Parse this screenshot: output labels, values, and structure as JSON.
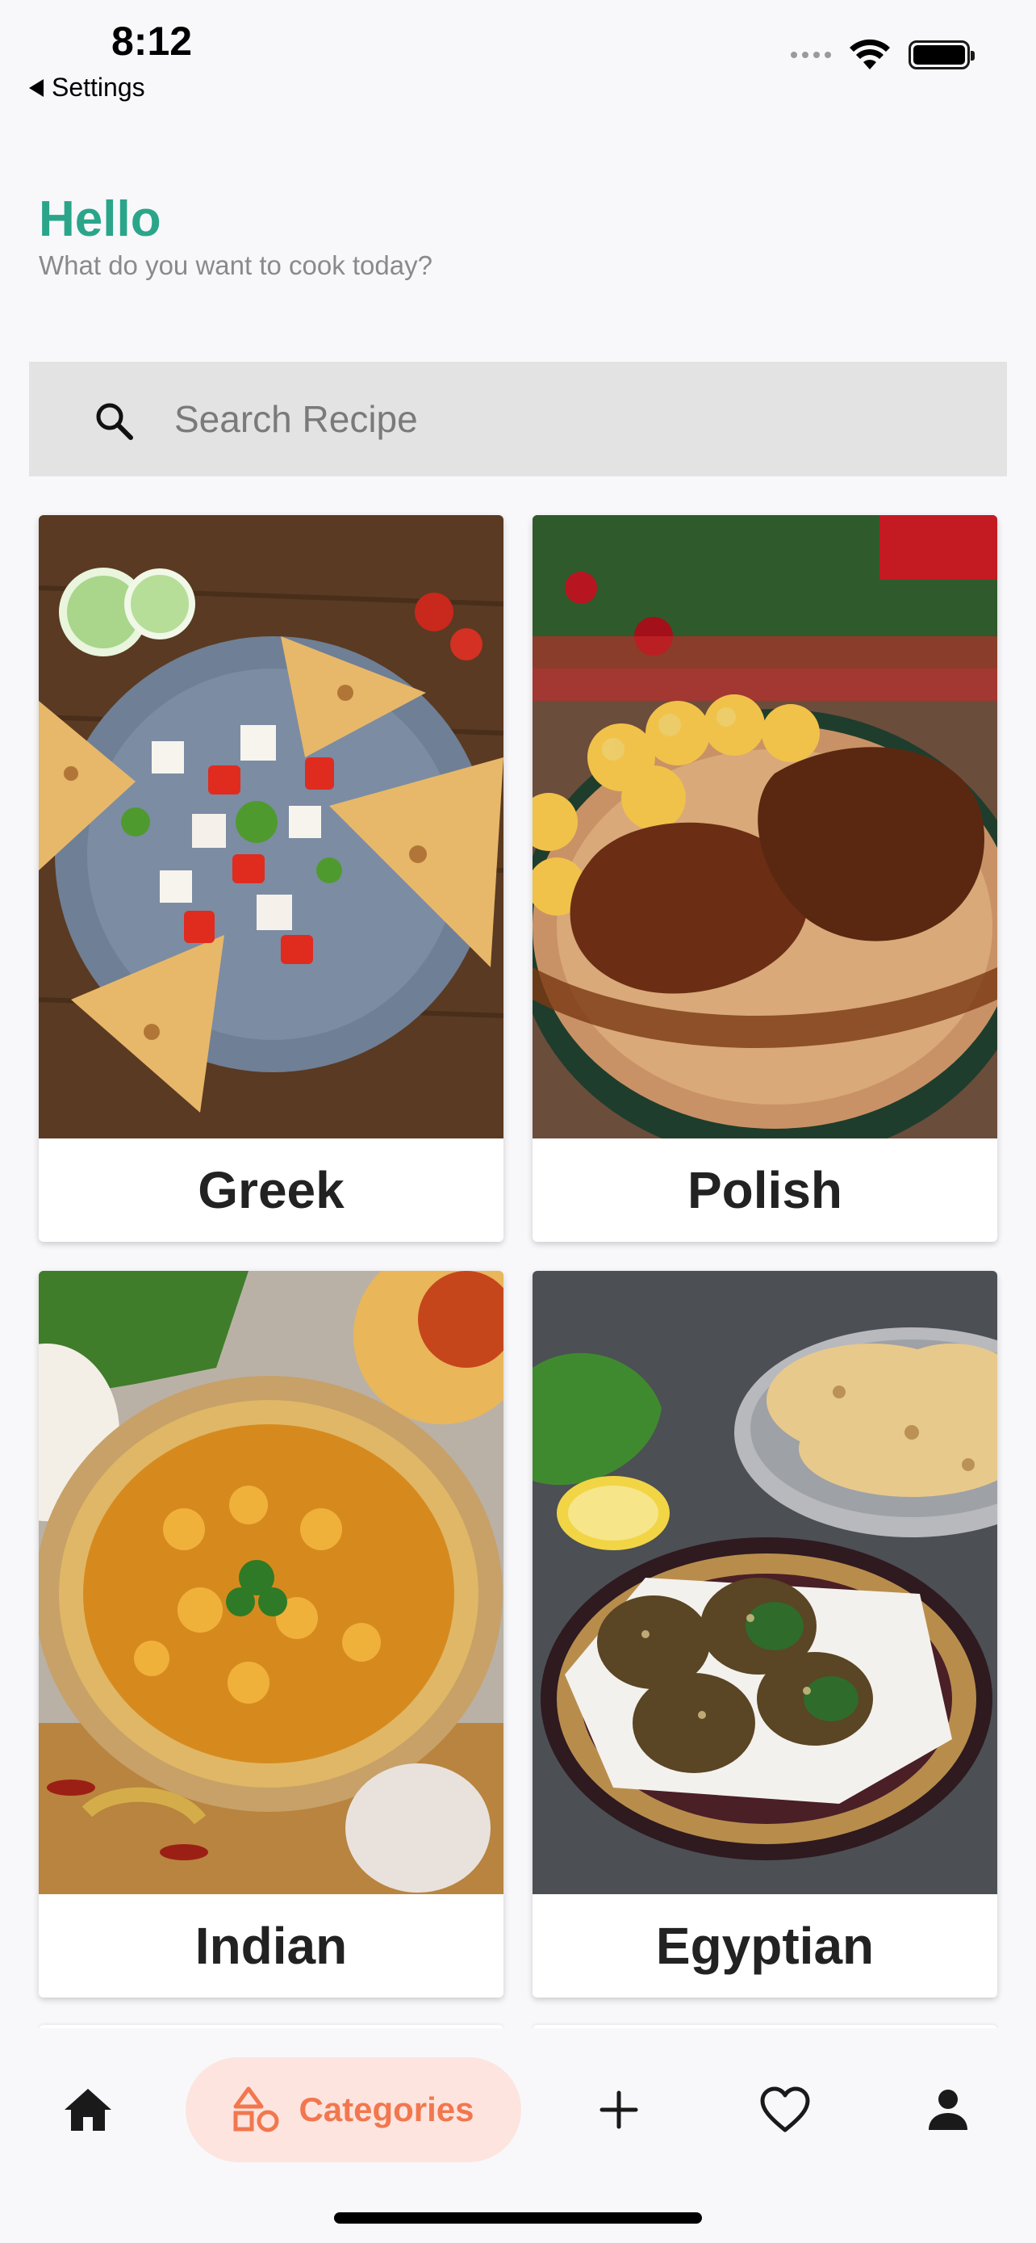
{
  "status_bar": {
    "time": "8:12",
    "back_label": "Settings"
  },
  "header": {
    "greeting": "Hello",
    "subtitle": "What do you want to cook today?"
  },
  "search": {
    "placeholder": "Search Recipe",
    "value": ""
  },
  "categories": [
    {
      "label": "Greek"
    },
    {
      "label": "Polish"
    },
    {
      "label": "Indian"
    },
    {
      "label": "Egyptian"
    }
  ],
  "bottom_nav": {
    "items": [
      {
        "icon": "home-icon",
        "label": "",
        "active": false
      },
      {
        "icon": "shapes-icon",
        "label": "Categories",
        "active": true
      },
      {
        "icon": "plus-icon",
        "label": "",
        "active": false
      },
      {
        "icon": "heart-icon",
        "label": "",
        "active": false
      },
      {
        "icon": "person-icon",
        "label": "",
        "active": false
      }
    ]
  },
  "colors": {
    "accent_green": "#2aa58a",
    "accent_orange": "#f2774e",
    "active_pill": "#fde4df"
  }
}
